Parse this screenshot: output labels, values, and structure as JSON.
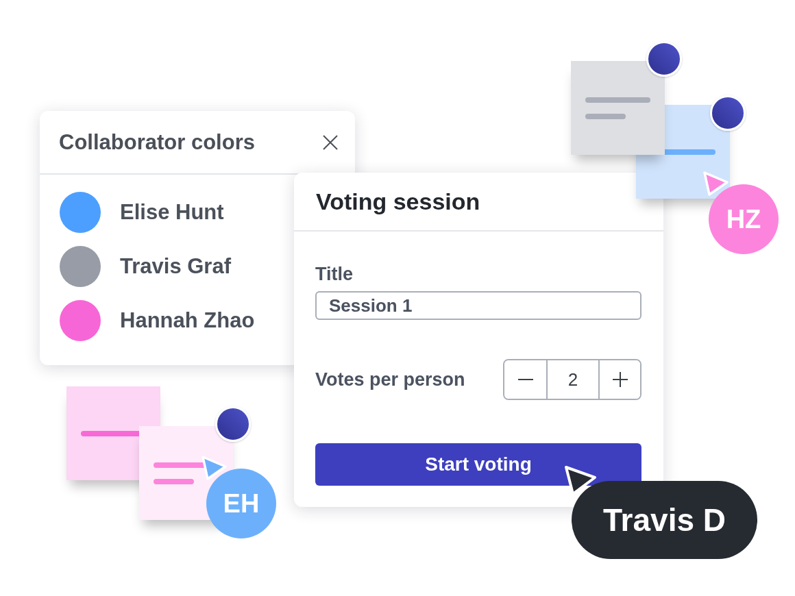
{
  "collaborator_panel": {
    "title": "Collaborator colors",
    "collaborators": [
      {
        "name": "Elise Hunt",
        "color": "#4c9ffe"
      },
      {
        "name": "Travis Graf",
        "color": "#979ca6"
      },
      {
        "name": "Hannah Zhao",
        "color": "#f766d6"
      }
    ]
  },
  "voting_panel": {
    "title": "Voting session",
    "title_field": {
      "label": "Title",
      "value": "Session 1"
    },
    "votes_per_person": {
      "label": "Votes per person",
      "value": "2"
    },
    "start_button": "Start voting"
  },
  "sticky_notes": [
    {
      "color": "#dddfe3",
      "lines": [
        {
          "color": "#a9aeb8"
        },
        {
          "color": "#a9aeb8"
        }
      ],
      "avatar": true
    },
    {
      "color": "#cfe3fc",
      "lines": [
        {
          "color": "#6cb0fc"
        }
      ],
      "avatar": true
    },
    {
      "color": "#fdd5f5",
      "lines": [
        {
          "color": "#f76ad6"
        }
      ],
      "avatar": false
    },
    {
      "color": "#feecfa",
      "lines": [
        {
          "color": "#fd84dd"
        },
        {
          "color": "#fd84dd"
        }
      ],
      "avatar": true
    }
  ],
  "cursors": [
    {
      "kind": "avatar",
      "label": "HZ",
      "color": "#fd84dd"
    },
    {
      "kind": "avatar",
      "label": "EH",
      "color": "#6cb0fc"
    },
    {
      "kind": "pill",
      "label": "Travis D",
      "color": "#262a31"
    }
  ]
}
